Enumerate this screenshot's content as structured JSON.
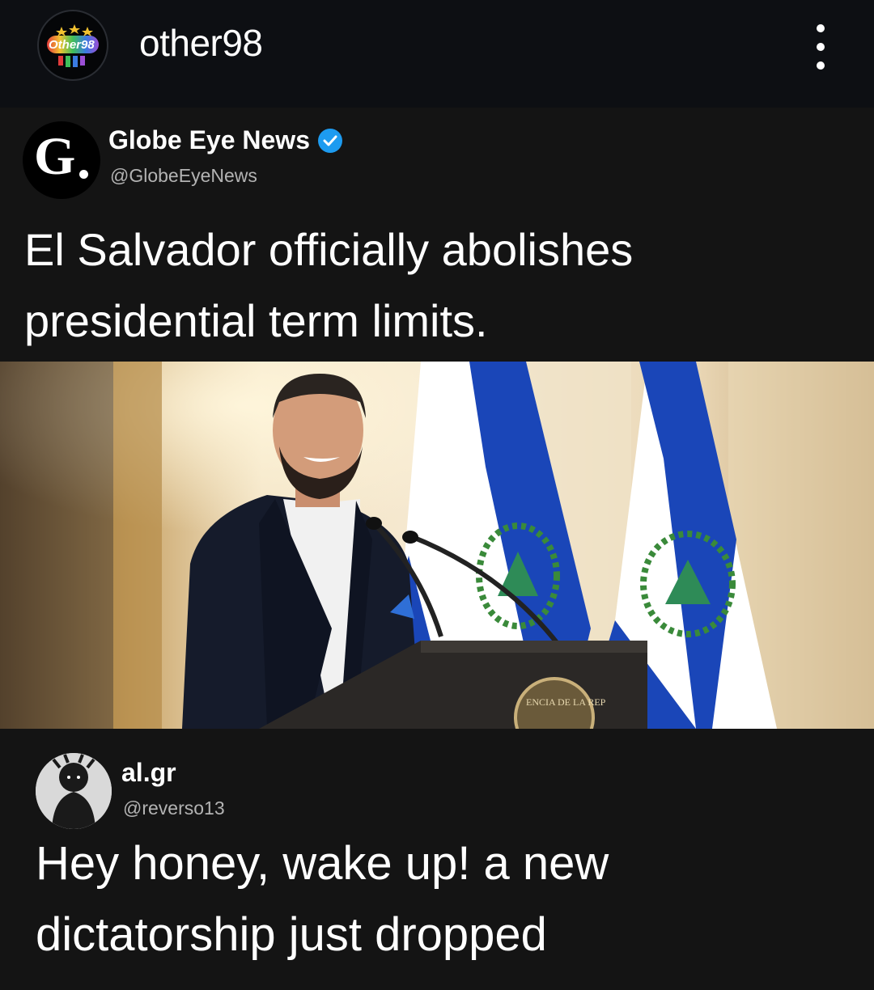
{
  "header": {
    "avatar_icon": "other98-logo-icon",
    "avatar_text": "Other98",
    "username": "other98",
    "more_icon": "more-vertical-icon"
  },
  "post": {
    "source": {
      "avatar_letter": "G",
      "name": "Globe Eye News",
      "verified_icon": "verified-badge-icon",
      "handle": "@GlobeEyeNews",
      "headline": "El Salvador officially abolishes presidential term limits."
    },
    "image_icon": "news-photo-president-at-podium",
    "podium_seal_text": "ENCIA DE LA REP",
    "reply": {
      "name": "al.gr",
      "handle": "@reverso13",
      "text": "Hey honey, wake up! a new dictatorship just dropped"
    }
  },
  "colors": {
    "background": "#0d0f13",
    "card": "#141414",
    "handle_gray": "#b3b3b3",
    "verified_blue": "#1d9bf0",
    "flag_blue": "#1a46b8"
  }
}
